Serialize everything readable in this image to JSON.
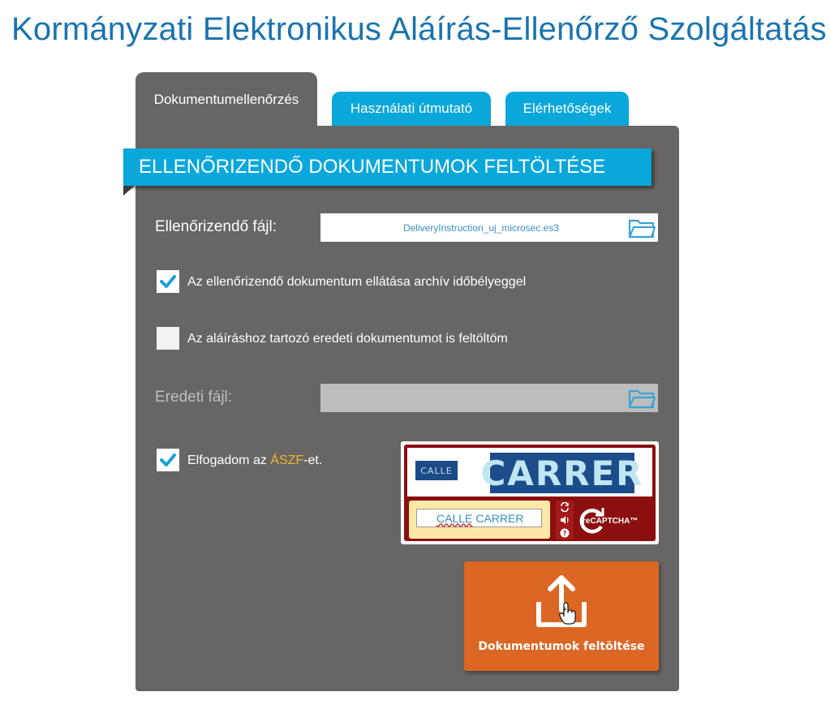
{
  "header": {
    "title": "Kormányzati Elektronikus Aláírás-Ellenőrző Szolgáltatás"
  },
  "tabs": [
    {
      "label": "Dokumentumellenőrzés",
      "active": true
    },
    {
      "label": "Használati útmutató",
      "active": false
    },
    {
      "label": "Elérhetőségek",
      "active": false
    }
  ],
  "section": {
    "title": "ELLENŐRIZENDŐ DOKUMENTUMOK FELTÖLTÉSE"
  },
  "form": {
    "file_label": "Ellenőrizendő fájl:",
    "file_value": "DeliveryInstruction_uj_microsec.es3",
    "archive_label": "Az ellenőrizendő dokumentum ellátása archív időbélyeggel",
    "archive_checked": true,
    "original_label": "Az aláíráshoz tartozó eredeti dokumentumot is feltöltöm",
    "original_checked": false,
    "original_file_label": "Eredeti fájl:",
    "terms_prefix": "Elfogadom az ",
    "terms_link": "ÁSZF",
    "terms_suffix": "-et.",
    "terms_checked": true
  },
  "captcha": {
    "small_word": "CALLE",
    "big_word": "CARRER",
    "answer_part1": "CALLE",
    "answer_part2": "CARRER",
    "logo_text": "reCAPTCHA™"
  },
  "upload": {
    "label": "Dokumentumok feltöltése"
  },
  "colors": {
    "title": "#1a74b0",
    "accent_blue": "#0aa7db",
    "panel": "#676664",
    "upload_orange": "#dc6624",
    "link_yellow": "#f2b431"
  }
}
